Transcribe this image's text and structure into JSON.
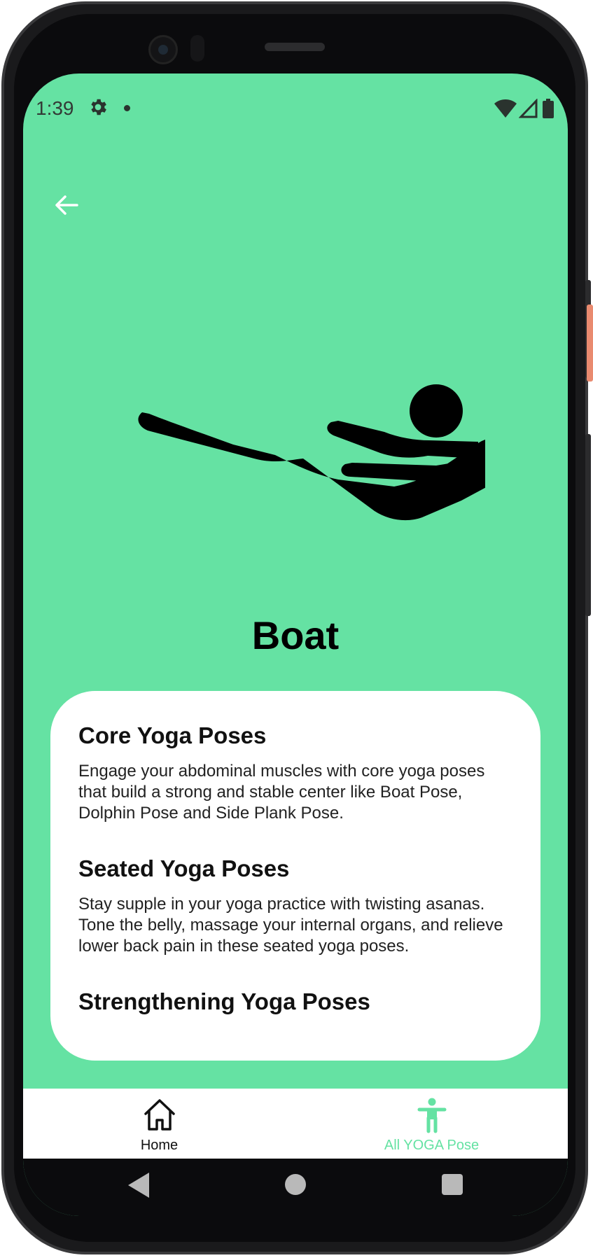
{
  "status_bar": {
    "time": "1:39",
    "icons": [
      "gear-icon",
      "notification-dot",
      "wifi-icon",
      "signal-icon",
      "battery-icon"
    ]
  },
  "header": {
    "back_icon": "arrow-left-icon"
  },
  "pose": {
    "name": "Boat",
    "illustration": "boat-pose-figure"
  },
  "sections": [
    {
      "title": "Core Yoga Poses",
      "body": "Engage your abdominal muscles with core yoga poses that build a strong and stable center like Boat Pose, Dolphin Pose and Side Plank Pose."
    },
    {
      "title": "Seated Yoga Poses",
      "body": "Stay supple in your yoga practice with twisting asanas. Tone the belly, massage your internal organs, and relieve lower back pain in these seated yoga poses."
    },
    {
      "title": "Strengthening Yoga Poses",
      "body": ""
    }
  ],
  "bottom_nav": {
    "items": [
      {
        "label": "Home",
        "icon": "home-icon",
        "active": false
      },
      {
        "label": "All YOGA Pose",
        "icon": "person-icon",
        "active": true
      }
    ]
  },
  "colors": {
    "accent": "#65e2a3",
    "card": "#ffffff",
    "text": "#111111"
  }
}
